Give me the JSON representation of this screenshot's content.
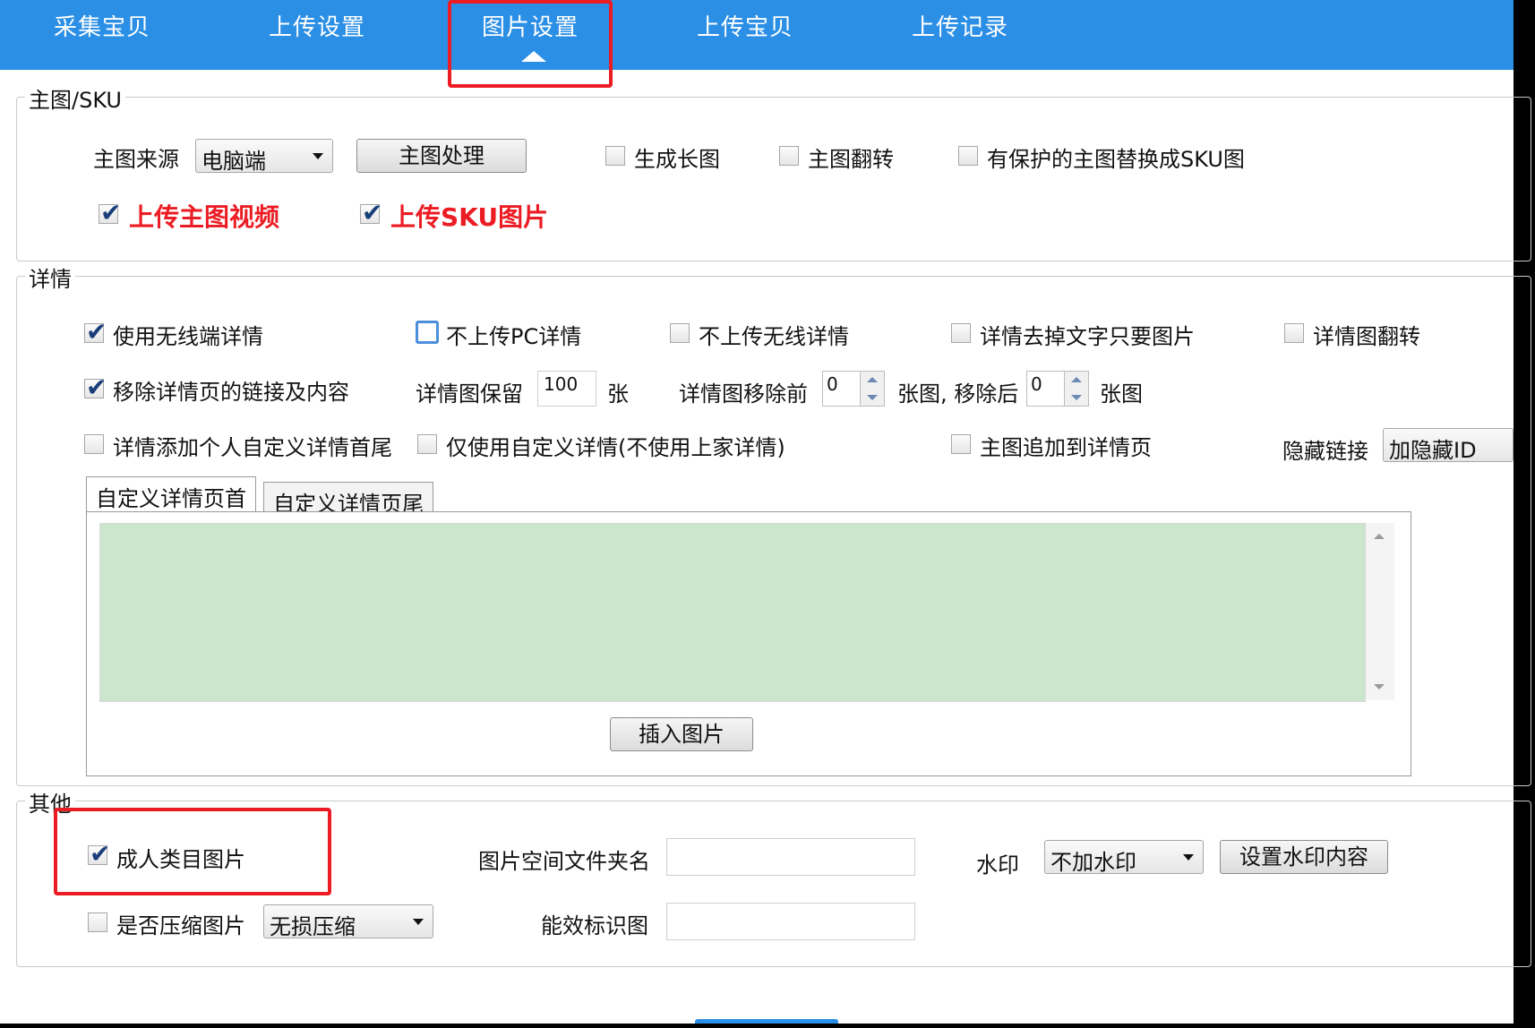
{
  "tabs": [
    "采集宝贝",
    "上传设置",
    "图片设置",
    "上传宝贝",
    "上传记录"
  ],
  "active_tab": "图片设置",
  "sections": {
    "main_sku": {
      "title": "主图/SKU",
      "source_label": "主图来源",
      "source_value": "电脑端",
      "process_button": "主图处理",
      "gen_long": "生成长图",
      "flip_main": "主图翻转",
      "replace_protected": "有保护的主图替换成SKU图",
      "upload_video": "上传主图视频",
      "upload_sku": "上传SKU图片"
    },
    "details": {
      "title": "详情",
      "use_wireless": "使用无线端详情",
      "no_pc": "不上传PC详情",
      "no_wireless": "不上传无线详情",
      "only_images": "详情去掉文字只要图片",
      "flip_detail": "详情图翻转",
      "remove_links": "移除详情页的链接及内容",
      "keep_label": "详情图保留",
      "keep_value": "100",
      "keep_unit": "张",
      "remove_before_label": "详情图移除前",
      "remove_before_value": "0",
      "remove_mid": "张图, 移除后",
      "remove_after_value": "0",
      "remove_unit": "张图",
      "add_custom": "详情添加个人自定义详情首尾",
      "custom_only": "仅使用自定义详情(不使用上家详情)",
      "append_main": "主图追加到详情页",
      "hide_link_label": "隐藏链接",
      "hide_link_value": "加隐藏ID",
      "tab_head": "自定义详情页首",
      "tab_tail": "自定义详情页尾",
      "insert_button": "插入图片"
    },
    "other": {
      "title": "其他",
      "adult": "成人类目图片",
      "folder_label": "图片空间文件夹名",
      "folder_value": "",
      "watermark_label": "水印",
      "watermark_value": "不加水印",
      "watermark_button": "设置水印内容",
      "compress_label": "是否压缩图片",
      "compress_value": "无损压缩",
      "energy_label": "能效标识图",
      "energy_value": ""
    }
  },
  "colors": {
    "topbar": "#2b8fe6",
    "highlight": "#ec1c24",
    "editor_bg": "#cbe6cc"
  }
}
